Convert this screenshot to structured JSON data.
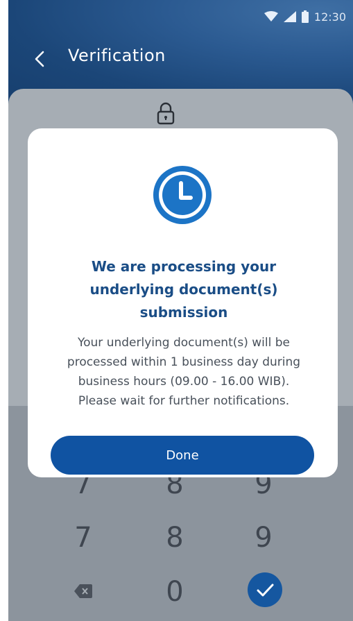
{
  "status_bar": {
    "time": "12:30"
  },
  "header": {
    "title": "Verification"
  },
  "keypad": {
    "partial_row": [
      "7",
      "8",
      "9"
    ],
    "row_789": [
      "7",
      "8",
      "9"
    ],
    "row_0": [
      "0"
    ]
  },
  "modal": {
    "title_lines": [
      "We are processing your",
      "underlying document(s)",
      "submission"
    ],
    "body_lines": [
      "Your underlying document(s) will be",
      "processed within 1 business day during",
      "business hours (09.00 - 16.00 WIB).",
      "Please wait for further notifications."
    ],
    "done_label": "Done"
  },
  "colors": {
    "brand_blue": "#1053a2",
    "header_blue": "#1b4678",
    "title_blue": "#1a4d86",
    "overlay_gray": "#a6adb4"
  },
  "icons": [
    "back-arrow-icon",
    "lock-icon",
    "clock-icon",
    "backspace-icon",
    "check-icon",
    "wifi-icon",
    "signal-icon",
    "battery-icon"
  ]
}
